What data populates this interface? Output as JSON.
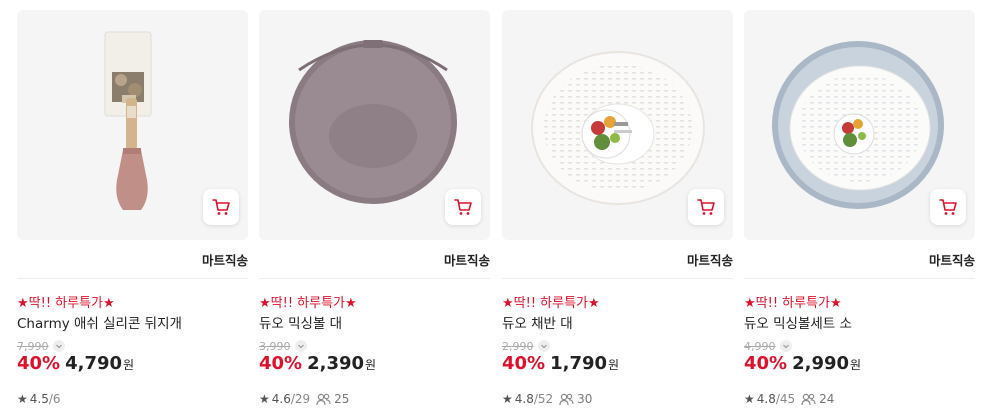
{
  "products": [
    {
      "seller": "마트직송",
      "promo": "★딱!! 하루특가★",
      "title": "Charmy 애쉬 실리콘 뒤지개",
      "original_price": "7,990",
      "discount": "40%",
      "price": "4,790",
      "currency": "원",
      "rating": "4.5",
      "reviews": "/6",
      "people": "",
      "image_icon": "silicone-spatula-image"
    },
    {
      "seller": "마트직송",
      "promo": "★딱!! 하루특가★",
      "title": "듀오 믹싱볼 대",
      "original_price": "3,990",
      "discount": "40%",
      "price": "2,390",
      "currency": "원",
      "rating": "4.6",
      "reviews": "/29",
      "people": "25",
      "image_icon": "mixing-bowl-image"
    },
    {
      "seller": "마트직송",
      "promo": "★딱!! 하루특가★",
      "title": "듀오 채반 대",
      "original_price": "2,990",
      "discount": "40%",
      "price": "1,790",
      "currency": "원",
      "rating": "4.8",
      "reviews": "/52",
      "people": "30",
      "image_icon": "colander-image"
    },
    {
      "seller": "마트직송",
      "promo": "★딱!! 하루특가★",
      "title": "듀오 믹싱볼세트 소",
      "original_price": "4,990",
      "discount": "40%",
      "price": "2,990",
      "currency": "원",
      "rating": "4.8",
      "reviews": "/45",
      "people": "24",
      "image_icon": "mixing-bowl-set-image"
    }
  ],
  "colors": {
    "accent_red": "#e0102a",
    "thumb_bg": "#f5f5f5",
    "bowl_mauve": "#8e7f86",
    "bowl_blue": "#aab8c8"
  },
  "icons": {
    "cart": "shopping-cart-icon",
    "star": "star-icon",
    "people": "people-icon",
    "chevron": "chevron-down-icon"
  }
}
